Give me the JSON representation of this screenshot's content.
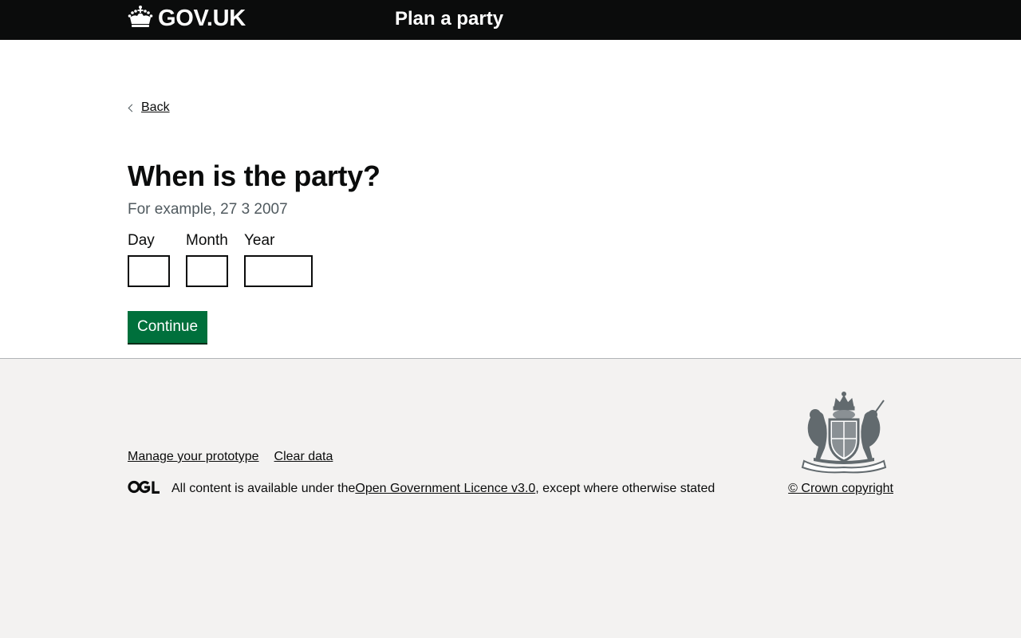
{
  "header": {
    "logo_text": "GOV.UK",
    "service_name": "Plan a party"
  },
  "main": {
    "back_label": "Back",
    "heading": "When is the party?",
    "hint": "For example, 27 3 2007",
    "date_fields": {
      "day_label": "Day",
      "month_label": "Month",
      "year_label": "Year",
      "day_value": "",
      "month_value": "",
      "year_value": ""
    },
    "continue_label": "Continue"
  },
  "footer": {
    "links": [
      "Manage your prototype",
      "Clear data"
    ],
    "licence_prefix": "All content is available under the ",
    "licence_link": "Open Government Licence v3.0",
    "licence_suffix": ", except where otherwise stated",
    "copyright": "© Crown copyright"
  },
  "colors": {
    "header_bg": "#0b0c0c",
    "accent_blue": "#1d70b8",
    "button_green": "#00703c",
    "footer_bg": "#f3f2f1"
  },
  "icons": [
    "crown-icon",
    "back-chevron-icon",
    "ogl-logo-icon",
    "royal-coat-of-arms-icon"
  ]
}
